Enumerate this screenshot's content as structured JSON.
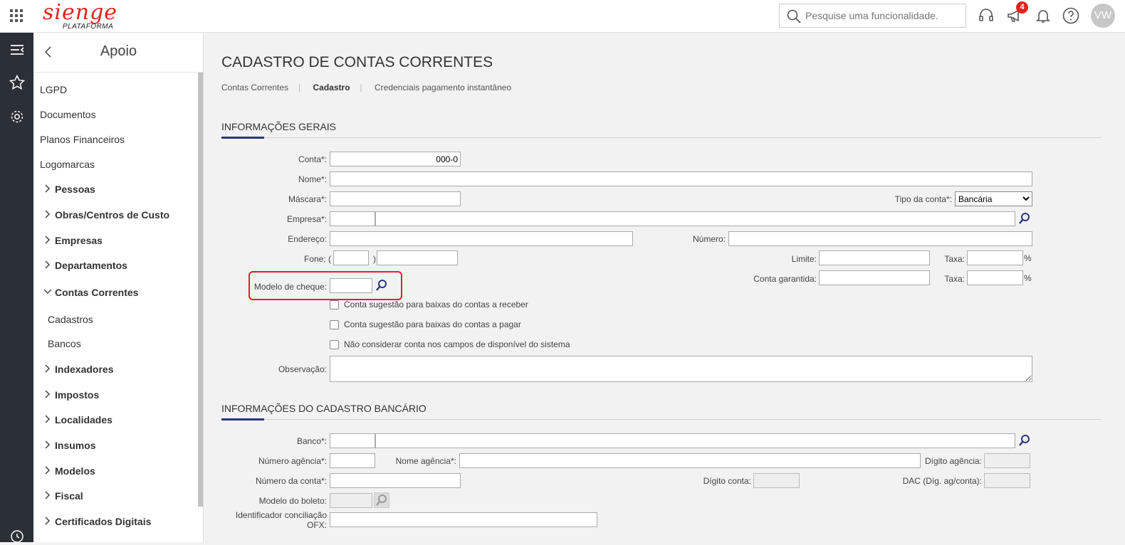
{
  "header": {
    "logo_text": "sienge",
    "logo_sub": "PLATAFORMA",
    "search_placeholder": "Pesquise uma funcionalidade.",
    "notification_count": "4",
    "avatar_initials": "VW",
    "brand_color": "#e0241a"
  },
  "rail": {
    "icons": [
      "menu-collapse-icon",
      "star-icon",
      "gear-icon",
      "history-icon"
    ]
  },
  "sidebar": {
    "title": "Apoio",
    "items": [
      {
        "label": "LGPD",
        "kind": "item"
      },
      {
        "label": "Documentos",
        "kind": "item"
      },
      {
        "label": "Planos Financeiros",
        "kind": "item"
      },
      {
        "label": "Logomarcas",
        "kind": "item"
      },
      {
        "label": "Pessoas",
        "kind": "group",
        "expanded": false
      },
      {
        "label": "Obras/Centros de Custo",
        "kind": "group",
        "expanded": false
      },
      {
        "label": "Empresas",
        "kind": "group",
        "expanded": false
      },
      {
        "label": "Departamentos",
        "kind": "group",
        "expanded": false
      },
      {
        "label": "Contas Correntes",
        "kind": "group",
        "expanded": true
      },
      {
        "label": "Cadastros",
        "kind": "sub"
      },
      {
        "label": "Bancos",
        "kind": "sub"
      },
      {
        "label": "Indexadores",
        "kind": "group",
        "expanded": false
      },
      {
        "label": "Impostos",
        "kind": "group",
        "expanded": false
      },
      {
        "label": "Localidades",
        "kind": "group",
        "expanded": false
      },
      {
        "label": "Insumos",
        "kind": "group",
        "expanded": false
      },
      {
        "label": "Modelos",
        "kind": "group",
        "expanded": false
      },
      {
        "label": "Fiscal",
        "kind": "group",
        "expanded": false
      },
      {
        "label": "Certificados Digitais",
        "kind": "group",
        "expanded": false
      }
    ]
  },
  "main": {
    "title": "CADASTRO DE CONTAS CORRENTES",
    "tabs": [
      "Contas Correntes",
      "Cadastro",
      "Credenciais pagamento instantâneo"
    ],
    "active_tab": "Cadastro",
    "section1": {
      "title": "INFORMAÇÕES GERAIS",
      "conta_label": "Conta*:",
      "conta_value": "000-0",
      "nome_label": "Nome*:",
      "mascara_label": "Máscara*:",
      "tipo_label": "Tipo da conta*:",
      "tipo_value": "Bancária",
      "empresa_label": "Empresa*:",
      "endereco_label": "Endereço:",
      "numero_label": "Número:",
      "fone_label": "Fone: (",
      "fone_close": ")",
      "limite_label": "Limite:",
      "taxa_label": "Taxa:",
      "percent": "%",
      "modelo_cheque_label": "Modelo de cheque:",
      "conta_garantida_label": "Conta garantida:",
      "checkboxes": [
        "Conta sugestão para baixas do contas a receber",
        "Conta sugestão para baixas do contas a pagar",
        "Não considerar conta nos campos de disponível do sistema"
      ],
      "observacao_label": "Observação:"
    },
    "section2": {
      "title": "INFORMAÇÕES DO CADASTRO BANCÁRIO",
      "banco_label": "Banco*:",
      "num_agencia_label": "Número agência*:",
      "nome_agencia_label": "Nome agência*:",
      "digito_agencia_label": "Dígito agência:",
      "num_conta_label": "Número da conta*:",
      "digito_conta_label": "Dígito conta:",
      "dac_label": "DAC (Díg. ag/conta):",
      "modelo_boleto_label": "Modelo do boleto:",
      "ofx_label_1": "Identificador conciliação",
      "ofx_label_2": "OFX:"
    },
    "accent_color": "#2a3680",
    "highlight_color": "#e0241a"
  }
}
